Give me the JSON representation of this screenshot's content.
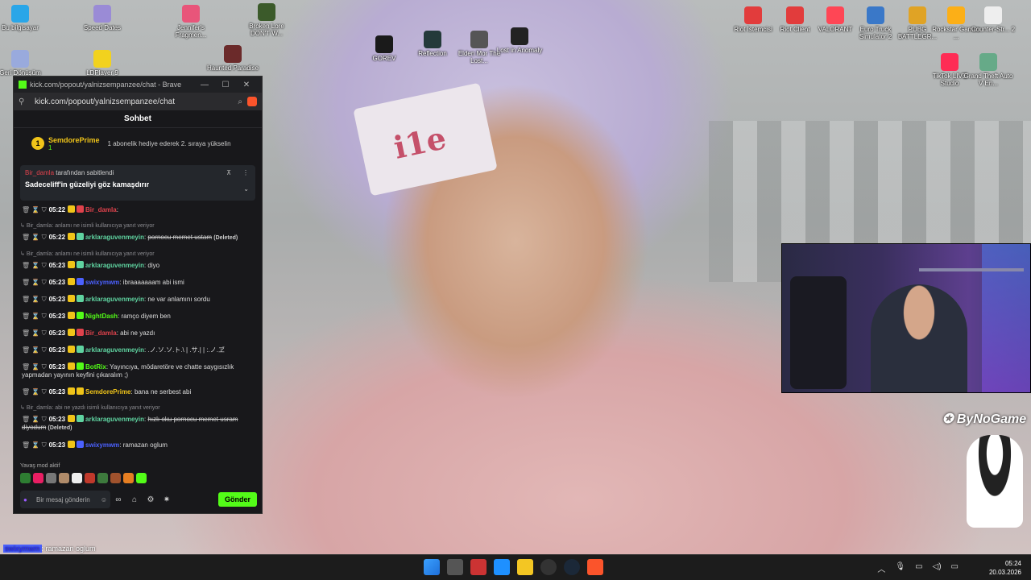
{
  "desktop_icons_left": [
    {
      "label": "Bu bilgisayar",
      "color": "#2aa6e8"
    },
    {
      "label": "Speed Dates",
      "color": "#9a8bd6"
    },
    {
      "label": "Jennifer's Fragmen...",
      "color": "#e8557a"
    },
    {
      "label": "Broken Lore DON'T W...",
      "color": "#3b5a2a"
    },
    {
      "label": "LDPlayer 9",
      "color": "#f2d21e"
    },
    {
      "label": "Haunted Paradise",
      "color": "#6b2a2a"
    },
    {
      "label": "Geri Dönüşüm",
      "color": "#9ad"
    }
  ],
  "desktop_icons_mid": [
    {
      "label": "GOREV",
      "color": "#1a1a1a"
    },
    {
      "label": "Reflection",
      "color": "#243a3a"
    },
    {
      "label": "Elden Mor The Lost...",
      "color": "#555"
    },
    {
      "label": "Lost in Anomaly",
      "color": "#222"
    }
  ],
  "desktop_icons_right": [
    {
      "label": "Riot İstemcisi",
      "color": "#e23c3c"
    },
    {
      "label": "Riot Client",
      "color": "#e23c3c"
    },
    {
      "label": "VALORANT",
      "color": "#ff4655"
    },
    {
      "label": "Euro Truck Simulator 2",
      "color": "#3a78c8"
    },
    {
      "label": "PUBG BATTLEGR...",
      "color": "#e0a325"
    },
    {
      "label": "Rockstar Games ...",
      "color": "#fcaf17"
    },
    {
      "label": "Counter-Str... 2",
      "color": "#eee"
    },
    {
      "label": "TikTok LIVE Studio",
      "color": "#fe2c55"
    },
    {
      "label": "Grand Theft Auto V En...",
      "color": "#6a8"
    }
  ],
  "chat_window": {
    "title": "kick.com/popout/yalnizsempanzee/chat - Brave",
    "url": "kick.com/popout/yalnizsempanzee/chat",
    "header": "Sohbet",
    "leader": {
      "rank": "1",
      "name": "SemdorePrime",
      "count": "1",
      "text": "1 abonelik hediye ederek 2. sıraya yükselin"
    },
    "pinned": {
      "by_user": "Bir_damla",
      "by_suffix": "tarafından sabitlendi",
      "text": "Sadeceliff'in güzeliyi göz kamaşdırır"
    },
    "messages": [
      {
        "reply": "",
        "time": "05:22",
        "user": "Bir_damla",
        "color": "#e0424c",
        "text": "",
        "deleted": false
      },
      {
        "reply": "Bir_damla: anlamı ne isimli kullanıcıya yanıt veriyor",
        "time": "05:22",
        "user": "arklaraguvenmeyin",
        "color": "#5fd3a0",
        "text": "pornocu memet ustam",
        "deleted": true,
        "delnote": "(Deleted)"
      },
      {
        "reply": "Bir_damla: anlamı ne isimli kullanıcıya yanıt veriyor",
        "time": "05:23",
        "user": "arklaraguvenmeyin",
        "color": "#5fd3a0",
        "text": "diyo",
        "deleted": false
      },
      {
        "reply": "",
        "time": "05:23",
        "user": "swixymwm",
        "color": "#4b61ff",
        "text": "ibraaaaaaam abi ismi",
        "deleted": false
      },
      {
        "reply": "",
        "time": "05:23",
        "user": "arklaraguvenmeyin",
        "color": "#5fd3a0",
        "text": "ne var anlamını sordu",
        "deleted": false
      },
      {
        "reply": "",
        "time": "05:23",
        "user": "NightDash",
        "color": "#53fc18",
        "text": "ramço diyem ben",
        "deleted": false
      },
      {
        "reply": "",
        "time": "05:23",
        "user": "Bir_damla",
        "color": "#e0424c",
        "text": "abi ne yazdı",
        "deleted": false
      },
      {
        "reply": "",
        "time": "05:23",
        "user": "arklaraguvenmeyin",
        "color": "#5fd3a0",
        "text": ".ノ.ソ.ソ.ト.\\ | .サ.| | :.ノ.ヹ",
        "deleted": false
      },
      {
        "reply": "",
        "time": "05:23",
        "user": "BotRix",
        "color": "#53fc18",
        "text": "Yayıncıya, mödaretöre ve chatte saygısızlık yapmadan yayının keyfini çıkaralım ;)",
        "deleted": false
      },
      {
        "reply": "",
        "time": "05:23",
        "user": "SemdorePrime",
        "color": "#f0c419",
        "text": "bana ne serbest abi",
        "deleted": false
      },
      {
        "reply": "Bir_damla: abi ne yazdı isimli kullanıcıya yanıt veriyor",
        "time": "05:23",
        "user": "arklaraguvenmeyin",
        "color": "#5fd3a0",
        "text": "hızlı oku pornocu memet usram diyodum",
        "deleted": true,
        "delnote": "(Deleted)"
      },
      {
        "reply": "",
        "time": "05:23",
        "user": "swixymwm",
        "color": "#4b61ff",
        "text": "ramazan oglum",
        "deleted": false
      }
    ],
    "slow_mode": "Yavaş mod aktif",
    "input_placeholder": "Bir mesaj gönderin",
    "send_label": "Gönder"
  },
  "overlay": {
    "brand": "ByNoGame",
    "chat_user": "swixymwm",
    "chat_text": ": ramazan oglum"
  },
  "taskbar": {
    "time": "05:24",
    "date": "20.03.2026"
  }
}
